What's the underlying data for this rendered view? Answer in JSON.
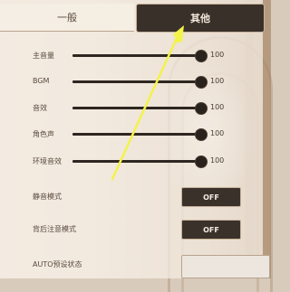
{
  "tabs": {
    "general_label": "一般",
    "other_label": "其他"
  },
  "sliders": [
    {
      "label": "主音量",
      "value": "100",
      "level_percent": 100
    },
    {
      "label": "BGM",
      "value": "100",
      "level_percent": 100
    },
    {
      "label": "音效",
      "value": "100",
      "level_percent": 100
    },
    {
      "label": "角色声",
      "value": "100",
      "level_percent": 100
    },
    {
      "label": "环境音效",
      "value": "100",
      "level_percent": 100
    }
  ],
  "toggles": [
    {
      "label": "静音模式",
      "state": "OFF"
    },
    {
      "label": "背后注意模式",
      "state": "OFF"
    },
    {
      "label": "AUTO预设状态",
      "state": ""
    }
  ],
  "colors": {
    "accent_arrow": "#f3f34a",
    "button_bg": "#3b312b",
    "panel_bg": "#f6f0e8"
  },
  "icons": {
    "annotation": "yellow-arrow-icon"
  }
}
